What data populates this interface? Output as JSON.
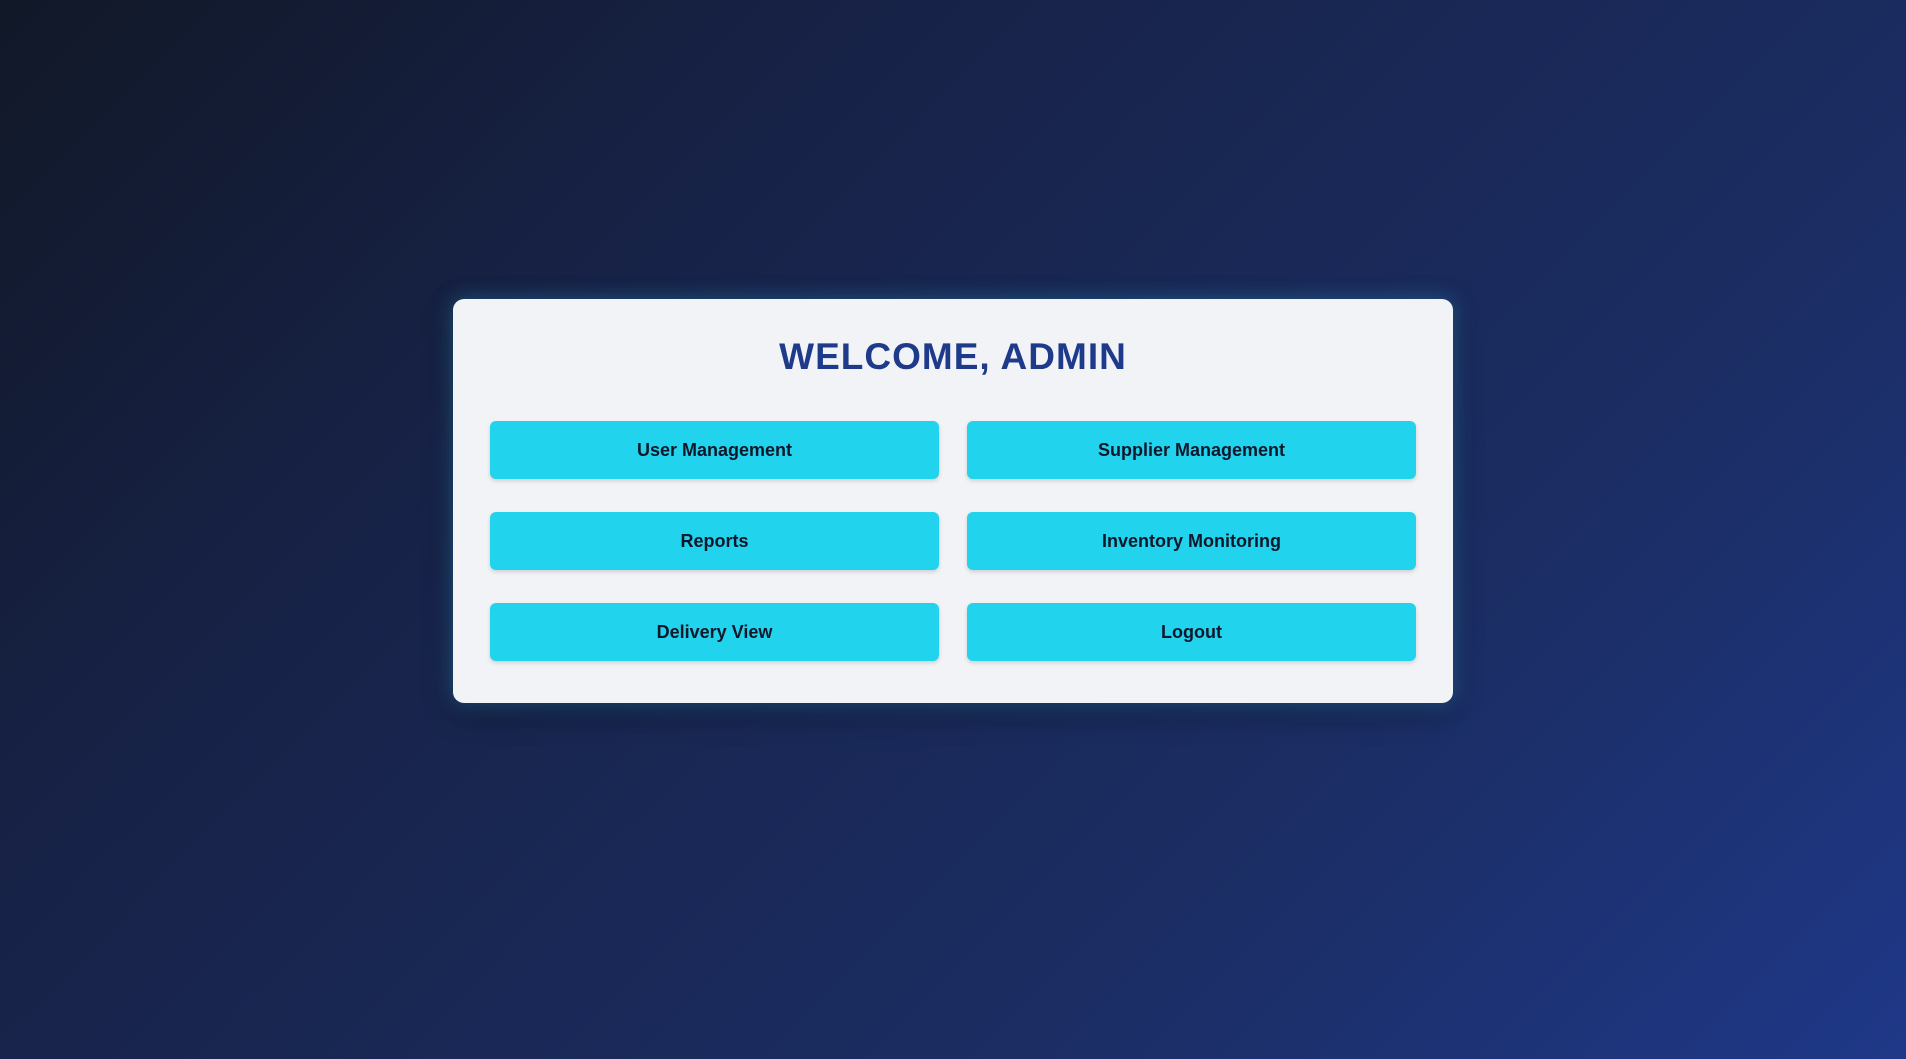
{
  "colors": {
    "panel_background": "#f1f3f6",
    "title": "#1e3a8a",
    "button_background": "#22d3ee",
    "button_text": "#0f172a",
    "page_gradient_start": "#111827",
    "page_gradient_end": "#1f3888"
  },
  "dashboard": {
    "title": "WELCOME, ADMIN",
    "buttons": [
      {
        "label": "User Management"
      },
      {
        "label": "Supplier Management"
      },
      {
        "label": "Reports"
      },
      {
        "label": "Inventory Monitoring"
      },
      {
        "label": "Delivery View"
      },
      {
        "label": "Logout"
      }
    ]
  }
}
